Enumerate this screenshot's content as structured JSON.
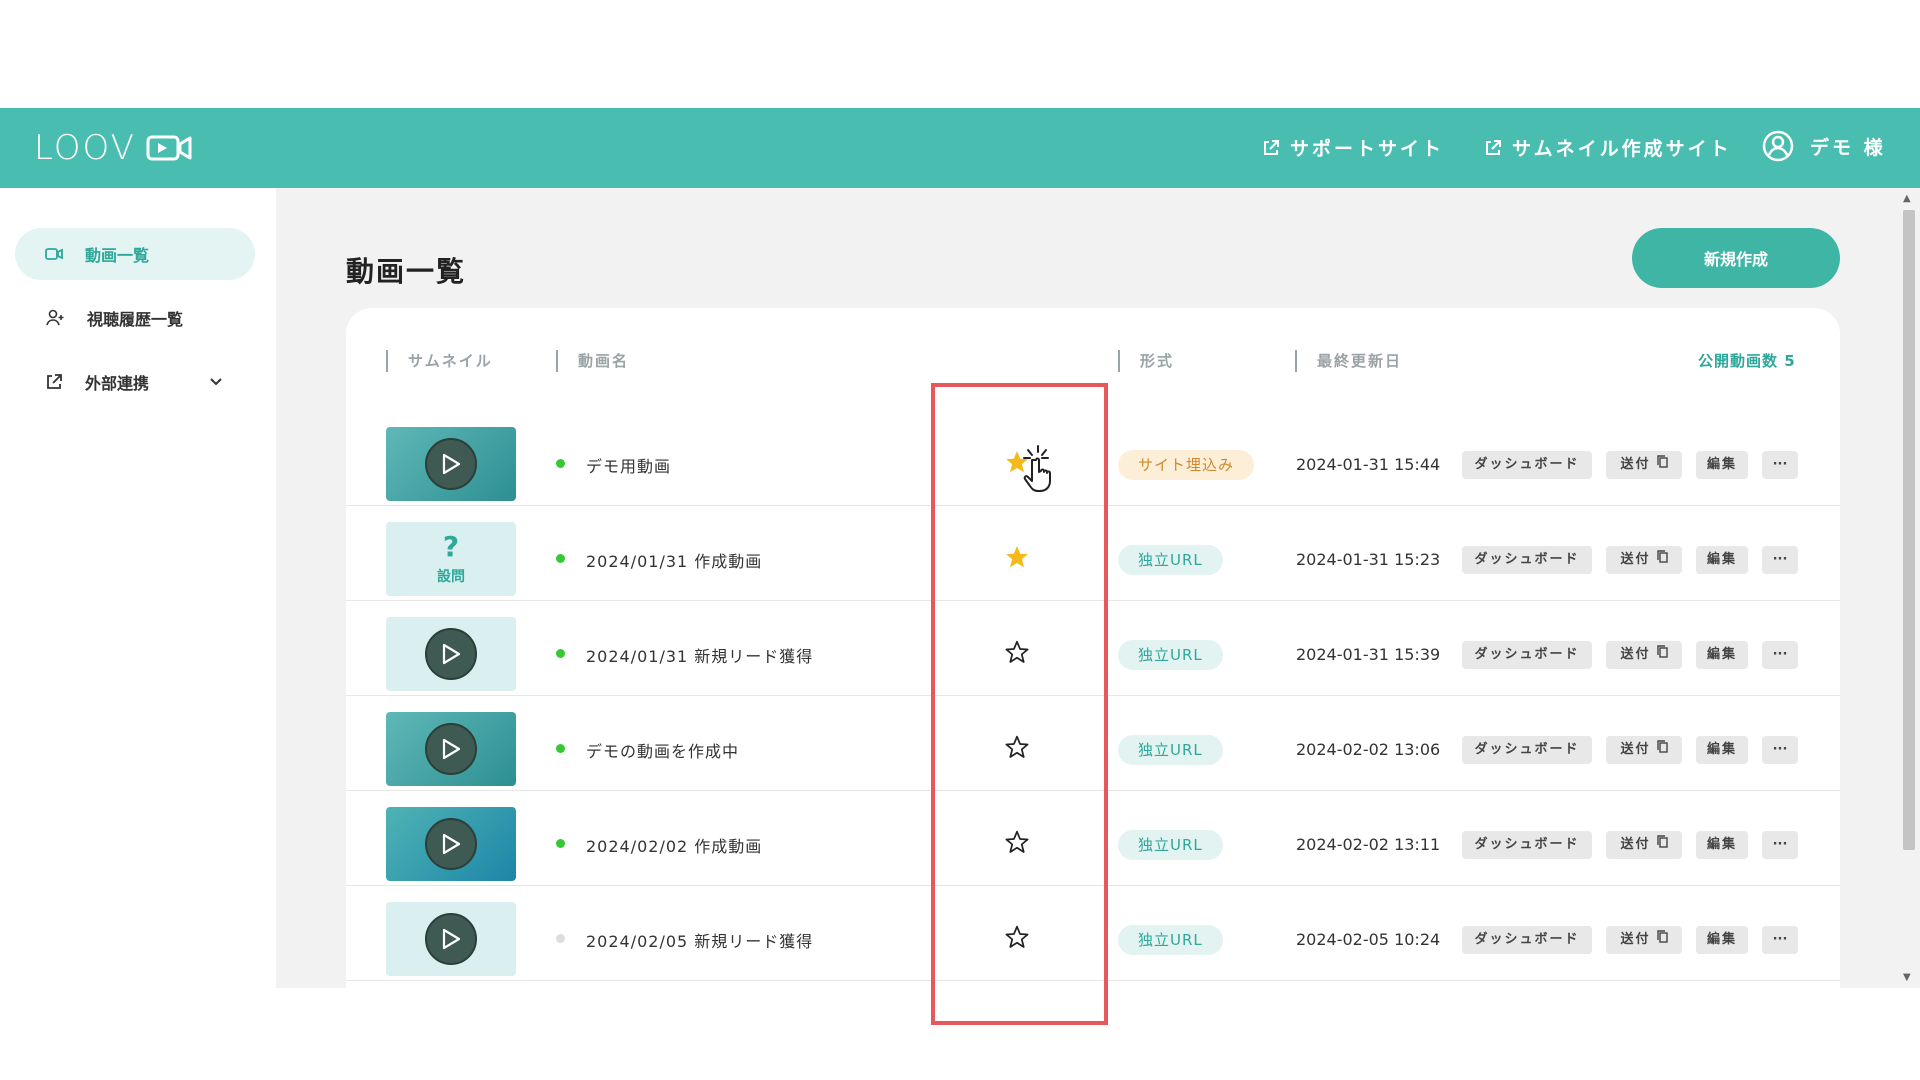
{
  "header": {
    "brand": "LOOV",
    "support_link": "サポートサイト",
    "thumbnail_link": "サムネイル作成サイト",
    "user_label": "デモ 様"
  },
  "sidebar": {
    "items": [
      {
        "label": "動画一覧",
        "icon": "video-camera-icon",
        "active": true
      },
      {
        "label": "視聴履歴一覧",
        "icon": "user-add-icon",
        "active": false
      },
      {
        "label": "外部連携",
        "icon": "external-link-icon",
        "active": false
      }
    ]
  },
  "main": {
    "title": "動画一覧",
    "new_button": "新規作成",
    "columns": {
      "thumbnail": "サムネイル",
      "name": "動画名",
      "format": "形式",
      "updated": "最終更新日"
    },
    "public_count": "公開動画数 5"
  },
  "row_actions": {
    "dashboard": "ダッシュボード",
    "send": "送付",
    "edit": "編集",
    "more": "···"
  },
  "videos": [
    {
      "name": "デモ用動画",
      "status": "public",
      "favorite": true,
      "format": "サイト埋込み",
      "format_type": "embed",
      "updated": "2024-01-31 15:44",
      "thumb": "teal"
    },
    {
      "name": "2024/01/31 作成動画",
      "status": "public",
      "favorite": true,
      "format": "独立URL",
      "format_type": "url",
      "updated": "2024-01-31 15:23",
      "thumb": "question",
      "thumb_label": "設問"
    },
    {
      "name": "2024/01/31 新規リード獲得",
      "status": "public",
      "favorite": false,
      "format": "独立URL",
      "format_type": "url",
      "updated": "2024-01-31 15:39",
      "thumb": "light"
    },
    {
      "name": "デモの動画を作成中",
      "status": "public",
      "favorite": false,
      "format": "独立URL",
      "format_type": "url",
      "updated": "2024-02-02 13:06",
      "thumb": "teal"
    },
    {
      "name": "2024/02/02 作成動画",
      "status": "public",
      "favorite": false,
      "format": "独立URL",
      "format_type": "url",
      "updated": "2024-02-02 13:11",
      "thumb": "blue"
    },
    {
      "name": "2024/02/05 新規リード獲得",
      "status": "draft",
      "favorite": false,
      "format": "独立URL",
      "format_type": "url",
      "updated": "2024-02-05 10:24",
      "thumb": "light"
    }
  ],
  "colors": {
    "header": "#49bdb0",
    "accent": "#3fb5a6",
    "star": "#f6b91c",
    "highlight": "#e8585b",
    "status_public": "#35c935",
    "status_draft": "#dddddd"
  }
}
